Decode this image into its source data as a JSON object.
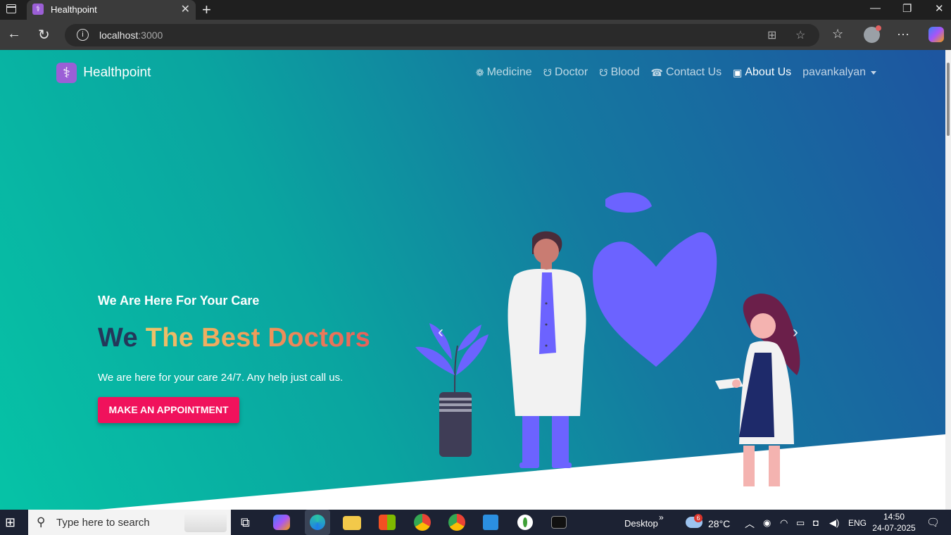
{
  "browser": {
    "tab_title": "Healthpoint",
    "tab_close": "✕",
    "new_tab": "+",
    "url_host": "localhost",
    "url_port": ":3000",
    "info_glyph": "i",
    "window_controls": {
      "minimize": "—",
      "restore": "❐",
      "close": "✕"
    },
    "toolbar_glyphs": {
      "back": "←",
      "reload": "↻",
      "apps": "⊞",
      "favorite": "☆",
      "favorites": "☆",
      "more": "···"
    }
  },
  "site": {
    "brand": "Healthpoint",
    "nav": [
      {
        "label": "Medicine",
        "icon": "pills-icon",
        "glyph": "❁"
      },
      {
        "label": "Doctor",
        "icon": "stethoscope-icon",
        "glyph": "☋"
      },
      {
        "label": "Blood",
        "icon": "stethoscope-icon",
        "glyph": "☋"
      },
      {
        "label": "Contact Us",
        "icon": "phone-icon",
        "glyph": "☎"
      },
      {
        "label": "About Us",
        "icon": "address-card-icon",
        "glyph": "▣"
      }
    ],
    "user_menu": "pavankalyan",
    "hero": {
      "subtitle": "We Are Here For Your Care",
      "title_plain": "We",
      "title_gradient": "The Best Doctors",
      "description": "We are here for your care 24/7. Any help just call us.",
      "cta": "MAKE AN APPOINTMENT"
    },
    "carousel": {
      "prev_glyph": "‹",
      "next_glyph": "›"
    },
    "colors": {
      "cta": "#f0125c",
      "brand_logo": "#9b5fd6",
      "gradient_start": "#06c3a6",
      "gradient_end": "#1d55a0",
      "illustration": "#6c63ff"
    }
  },
  "taskbar": {
    "search_placeholder": "Type here to search",
    "desktop_label": "Desktop",
    "weather_temp": "28°C",
    "weather_badge": "6",
    "language": "ENG",
    "time": "14:50",
    "date": "24-07-2025",
    "glyphs": {
      "start": "⊞",
      "search": "⚲",
      "taskview": "⧉",
      "overflow": "»",
      "tray_up": "︿",
      "notifications": "🗨"
    },
    "apps": [
      "copilot-app",
      "edge-app",
      "file-explorer-app",
      "store-app",
      "chrome-app",
      "chrome-profile-app",
      "vscode-app",
      "mongodb-app",
      "terminal-app"
    ]
  }
}
